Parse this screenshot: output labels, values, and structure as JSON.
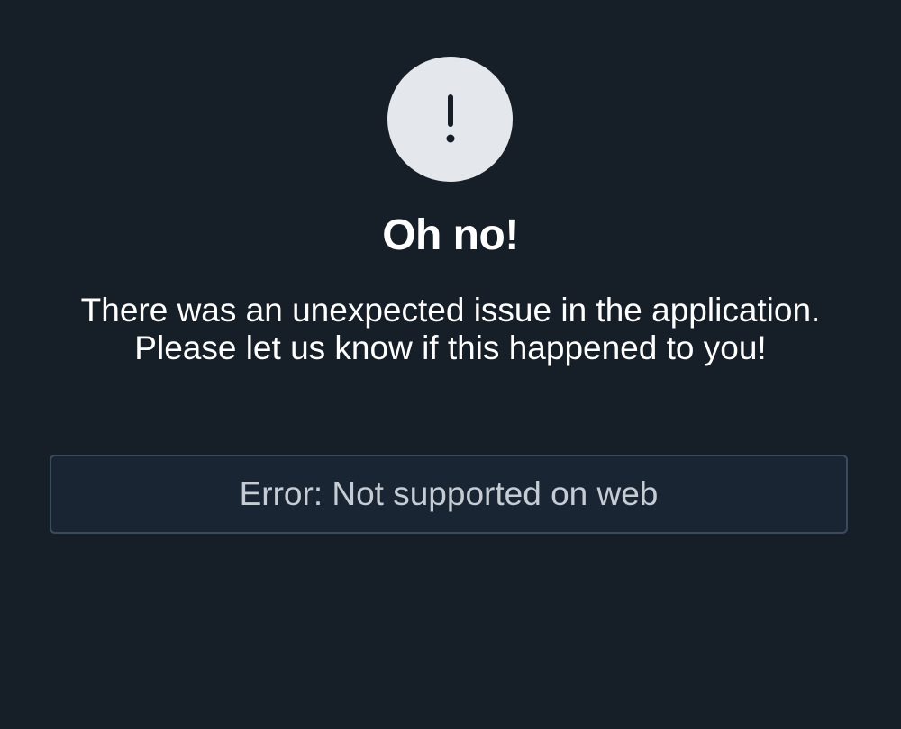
{
  "icon": {
    "name": "exclamation-icon",
    "background": "#e4e7ec",
    "glyph_color": "#161e28"
  },
  "title": "Oh no!",
  "message": "There was an unexpected issue in the application. Please let us know if this happened to you!",
  "error": {
    "text": "Error: Not supported on web"
  },
  "colors": {
    "background": "#161e28",
    "error_box_border": "#3a4b5e",
    "error_box_fill": "#1a2533",
    "error_text": "#c6ccd4"
  }
}
